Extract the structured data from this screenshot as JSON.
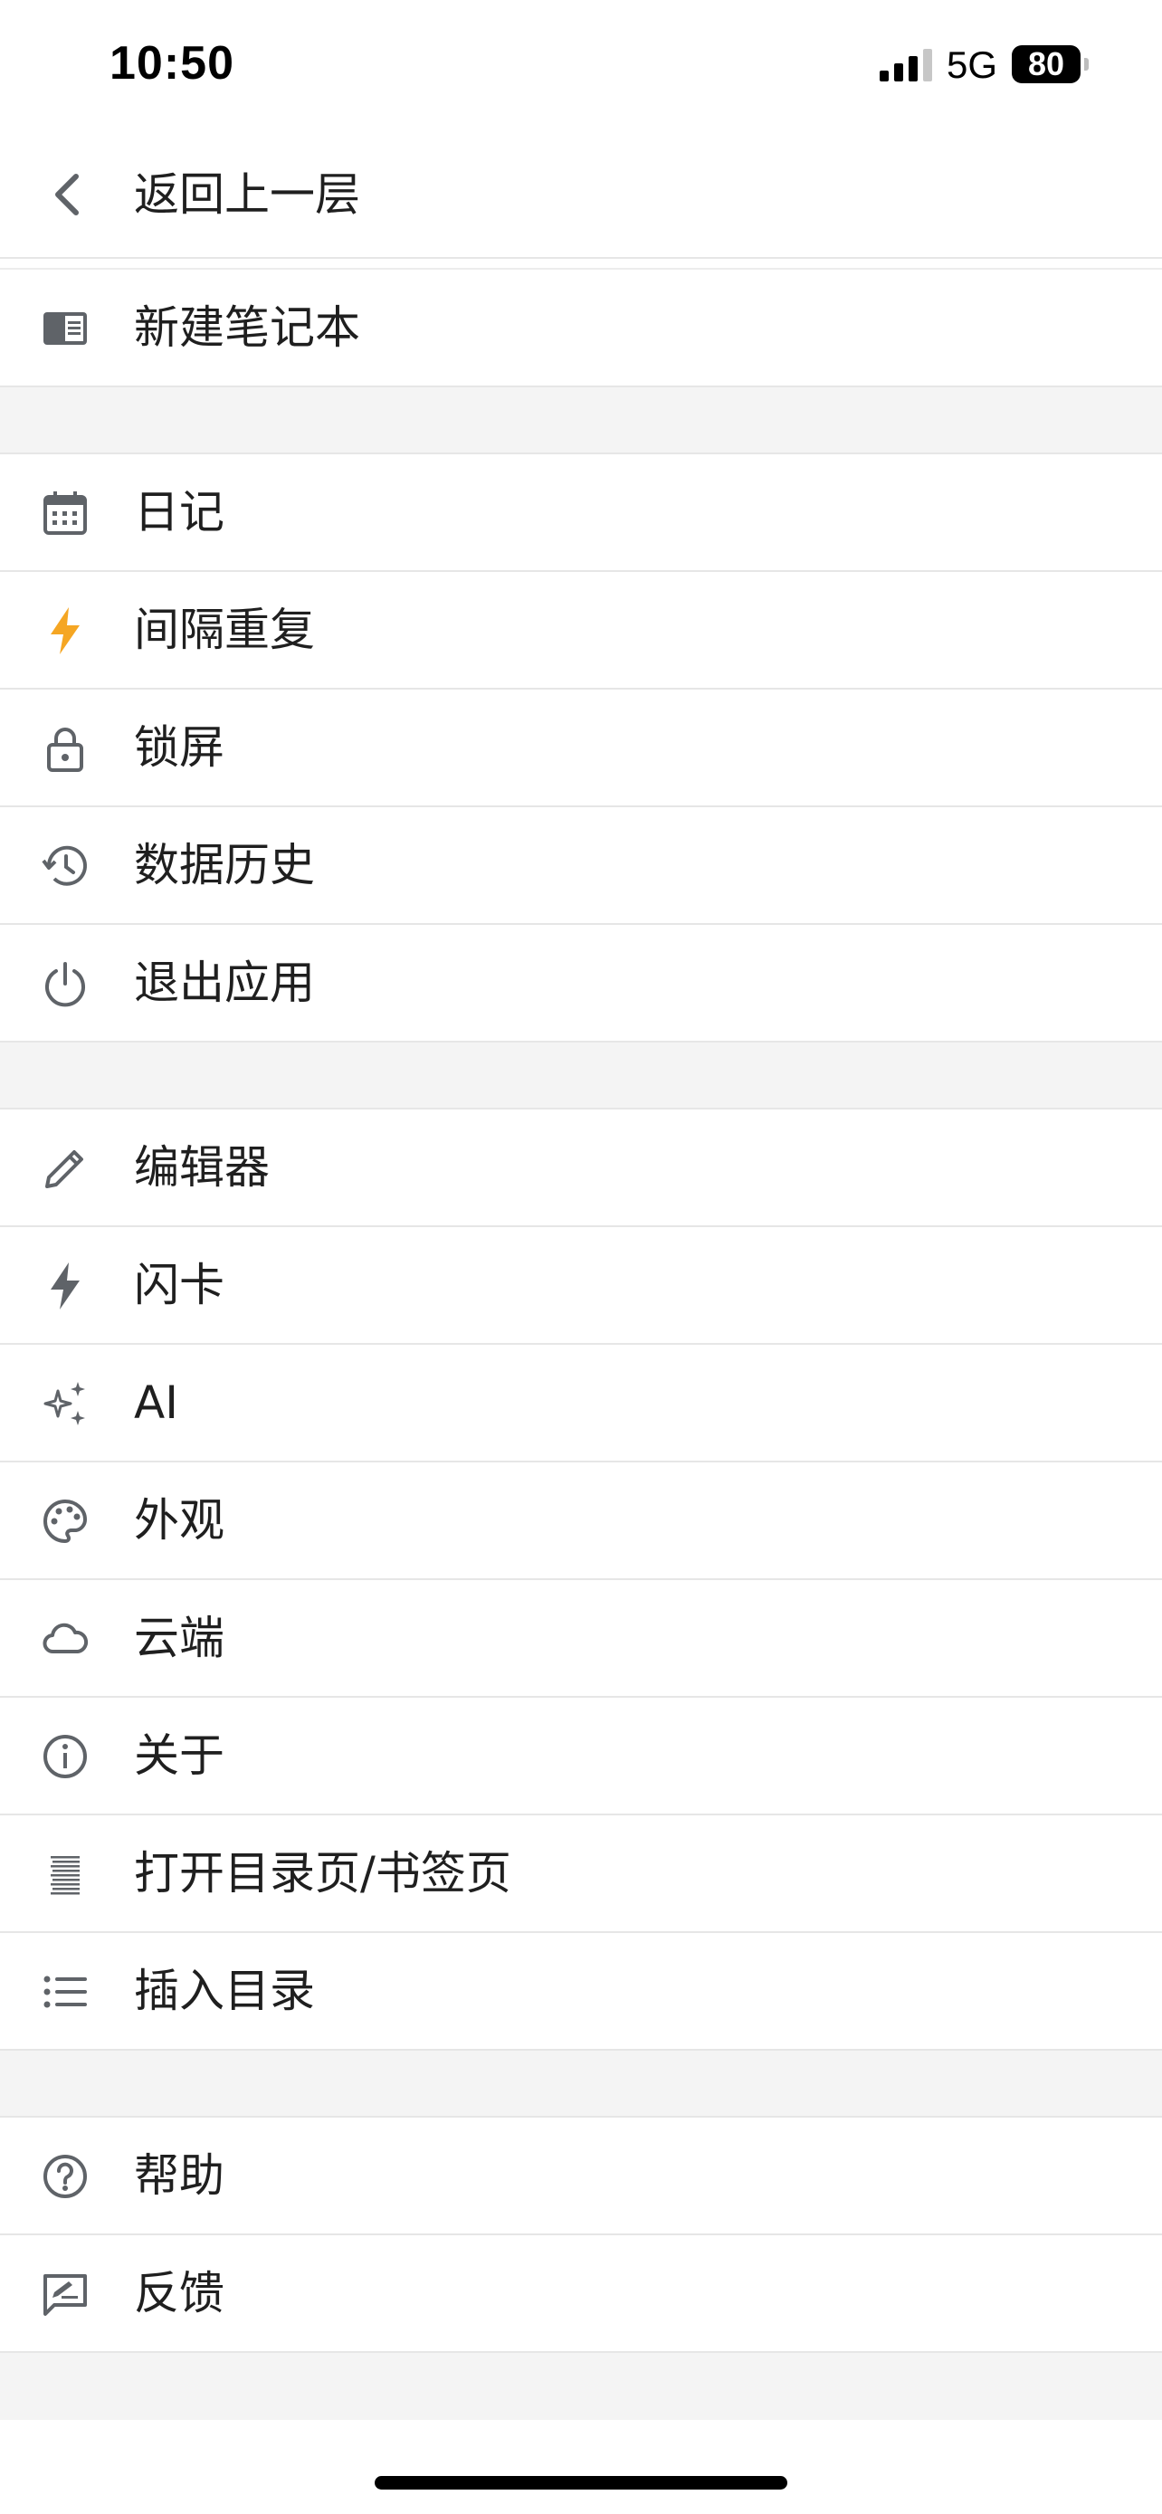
{
  "status_bar": {
    "time": "10:50",
    "network": "5G",
    "battery": "80"
  },
  "header": {
    "back_label": "返回上一层"
  },
  "section_new": {
    "items": [
      {
        "label": "新建笔记本",
        "icon": "notebook-icon"
      }
    ]
  },
  "section_tools": {
    "items": [
      {
        "label": "日记",
        "icon": "calendar-icon"
      },
      {
        "label": "间隔重复",
        "icon": "lightning-icon",
        "color": "#f5a623"
      },
      {
        "label": "锁屏",
        "icon": "lock-icon"
      },
      {
        "label": "数据历史",
        "icon": "history-icon"
      },
      {
        "label": "退出应用",
        "icon": "power-icon"
      }
    ]
  },
  "section_settings": {
    "items": [
      {
        "label": "编辑器",
        "icon": "pencil-icon"
      },
      {
        "label": "闪卡",
        "icon": "flash-icon"
      },
      {
        "label": "AI",
        "icon": "sparkle-icon"
      },
      {
        "label": "外观",
        "icon": "palette-icon"
      },
      {
        "label": "云端",
        "icon": "cloud-icon"
      },
      {
        "label": "关于",
        "icon": "info-icon"
      },
      {
        "label": "打开目录页/书签页",
        "icon": "outline-icon"
      },
      {
        "label": "插入目录",
        "icon": "list-icon"
      }
    ]
  },
  "section_support": {
    "items": [
      {
        "label": "帮助",
        "icon": "help-icon"
      },
      {
        "label": "反馈",
        "icon": "feedback-icon"
      }
    ]
  },
  "colors": {
    "icon": "#5f6368",
    "accent": "#f5a623",
    "divider": "#e6e6e6",
    "gap": "#f4f4f4"
  }
}
